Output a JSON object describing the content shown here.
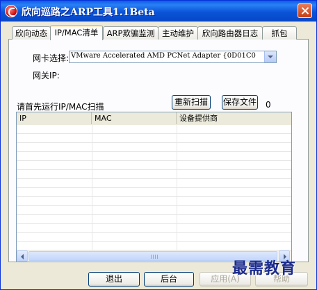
{
  "window": {
    "title": "欣向巡路之ARP工具1.1Beta"
  },
  "tabs": [
    {
      "label": "欣向动态"
    },
    {
      "label": "IP/MAC清单"
    },
    {
      "label": "ARP欺骗监测"
    },
    {
      "label": "主动维护"
    },
    {
      "label": "欣向路由器日志"
    },
    {
      "label": "抓包"
    }
  ],
  "form": {
    "nic_label": "网卡选择:",
    "nic_value": "VMware Accelerated AMD PCNet Adapter     {0D01C0",
    "gateway_label": "网关IP:"
  },
  "scan": {
    "hint": "请首先运行IP/MAC扫描",
    "rescan_label": "重新扫描",
    "save_label": "保存文件",
    "count": "0"
  },
  "table": {
    "columns": [
      "IP",
      "MAC",
      "设备提供商"
    ],
    "rows": []
  },
  "footer": {
    "exit": "退出",
    "background": "后台",
    "apply": "应用(A)",
    "help": "帮助"
  },
  "watermark": "最需教育"
}
